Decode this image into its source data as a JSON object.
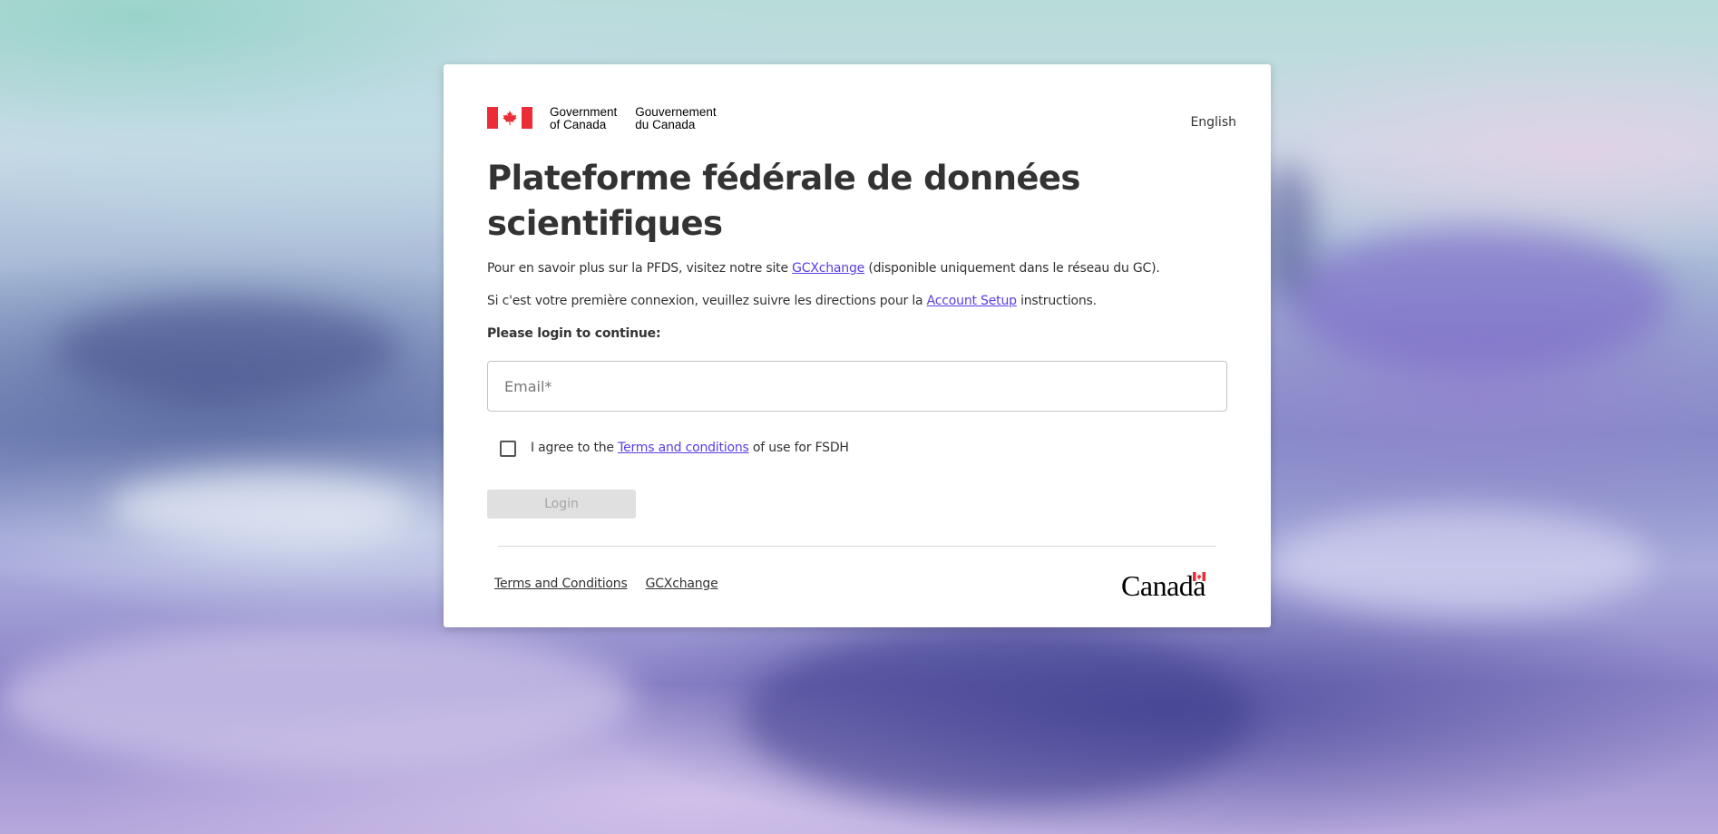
{
  "header": {
    "signature_en": "Government\nof Canada",
    "signature_fr": "Gouvernement\ndu Canada",
    "language_toggle": "English"
  },
  "title": "Plateforme fédérale de données scientifiques",
  "intro": {
    "line1_before": "Pour en savoir plus sur la PFDS, visitez notre site ",
    "line1_link": "GCXchange",
    "line1_after": " (disponible uniquement dans le réseau du GC).",
    "line2_before": "Si c'est votre première connexion, veuillez suivre les directions pour la ",
    "line2_link": "Account Setup",
    "line2_after": " instructions."
  },
  "login": {
    "prompt": "Please login to continue:",
    "email_placeholder": "Email*",
    "email_value": "",
    "agree_before": "I agree to the ",
    "agree_link": "Terms and conditions",
    "agree_after": " of use for FSDH",
    "agree_checked": false,
    "button_label": "Login",
    "button_disabled": true
  },
  "footer": {
    "links": [
      "Terms and Conditions",
      "GCXchange"
    ],
    "wordmark": "Canada"
  },
  "colors": {
    "flag_red": "#eb2d37",
    "link": "#5a3ee2",
    "title_text": "#333333",
    "disabled_button_bg": "#e0e0e0"
  },
  "icons": {
    "flag": "canada-flag-icon",
    "checkbox": "checkbox-unchecked-icon"
  }
}
